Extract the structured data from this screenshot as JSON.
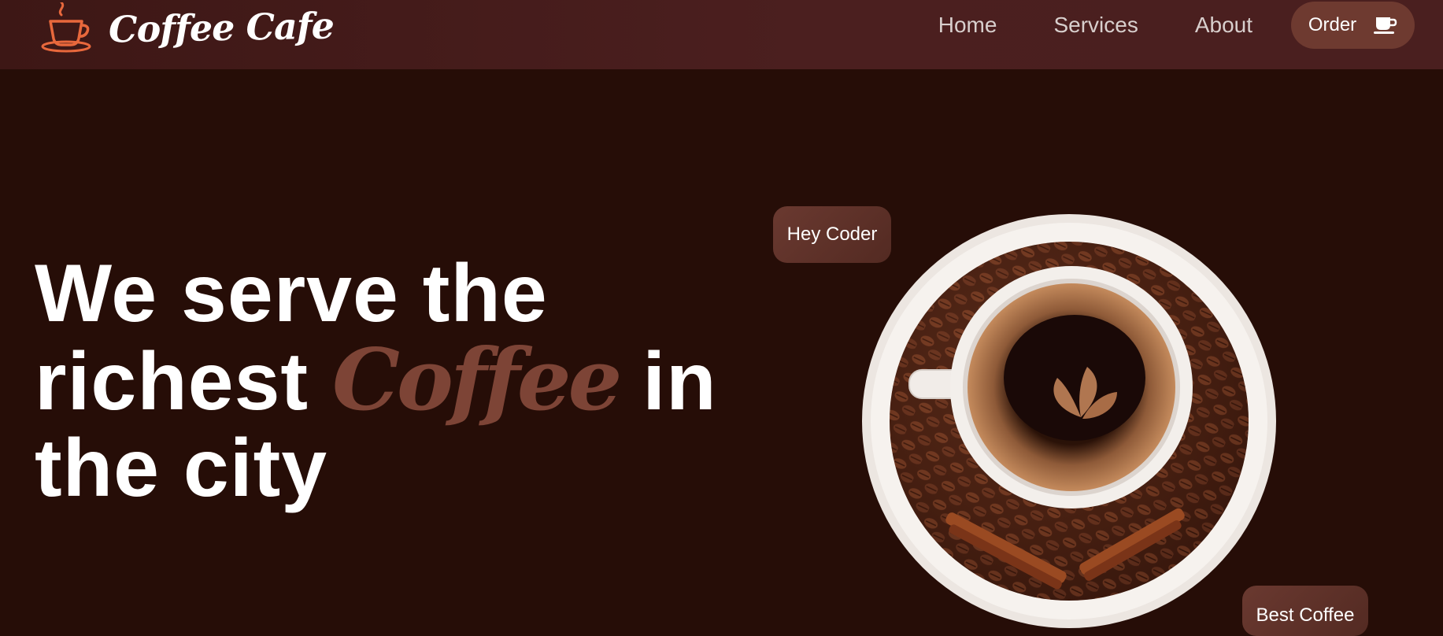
{
  "header": {
    "brand_name": "Coffee Cafe",
    "brand_icon": "coffee-cup-icon",
    "nav": [
      {
        "label": "Home"
      },
      {
        "label": "Services"
      },
      {
        "label": "About"
      }
    ],
    "order_button": {
      "label": "Order",
      "icon": "coffee-cup-icon"
    }
  },
  "hero": {
    "title_part1": "We serve the",
    "title_part2": "richest",
    "title_accent": "Coffee",
    "title_part3": "in",
    "title_part4": "the city",
    "image_tags": [
      "Hey Coder",
      "Best Coffee"
    ]
  },
  "colors": {
    "background": "#260d07",
    "header": "#4a1f1f",
    "accent": "#7d4436",
    "button": "#6e3a30",
    "logo": "#e8683c"
  }
}
